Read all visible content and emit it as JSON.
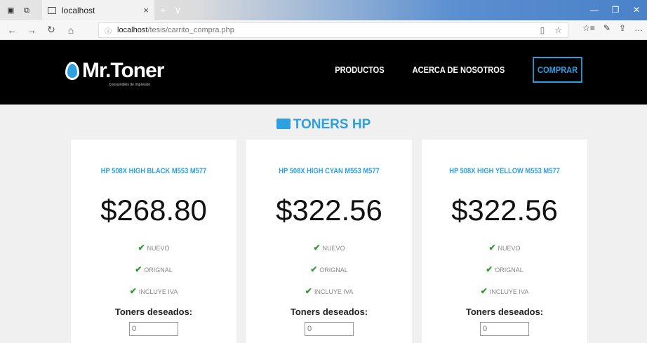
{
  "browser": {
    "tab_title": "localhost",
    "tab_close": "×",
    "new_tab": "+",
    "tab_menu": "∨",
    "url_host": "localhost",
    "url_path": "/tesis/carrito_compra.php",
    "win_min": "—",
    "win_restore": "❐",
    "win_close": "✕",
    "back": "←",
    "forward": "→",
    "refresh": "↻",
    "home": "⌂",
    "info": "ⓘ",
    "reading": "▯",
    "fav": "☆",
    "favlist": "☆≡",
    "pen": "✎",
    "share": "⇪",
    "more": "…"
  },
  "site": {
    "brand": "Mr.Toner",
    "brand_sub": "Consumibles de Impresión",
    "nav": {
      "products": "PRODUCTOS",
      "about": "ACERCA DE NOSOTROS",
      "buy": "COMPRAR"
    },
    "section_title": "TONERS HP"
  },
  "products": [
    {
      "name": "HP 508X HIGH BLACK M553 M577",
      "price": "$268.80",
      "features": [
        "NUEVO",
        "ORIGNAL",
        "INCLUYE IVA"
      ],
      "qty_label": "Toners deseados:",
      "qty_value": "0"
    },
    {
      "name": "HP 508X HIGH CYAN M553 M577",
      "price": "$322.56",
      "features": [
        "NUEVO",
        "ORIGNAL",
        "INCLUYE IVA"
      ],
      "qty_label": "Toners deseados:",
      "qty_value": "0"
    },
    {
      "name": "HP 508X HIGH YELLOW M553 M577",
      "price": "$322.56",
      "features": [
        "NUEVO",
        "ORIGNAL",
        "INCLUYE IVA"
      ],
      "qty_label": "Toners deseados:",
      "qty_value": "0"
    }
  ],
  "colors": {
    "accent": "#2ca0e0",
    "check": "#2e9a2e",
    "header_bg": "#000000"
  }
}
